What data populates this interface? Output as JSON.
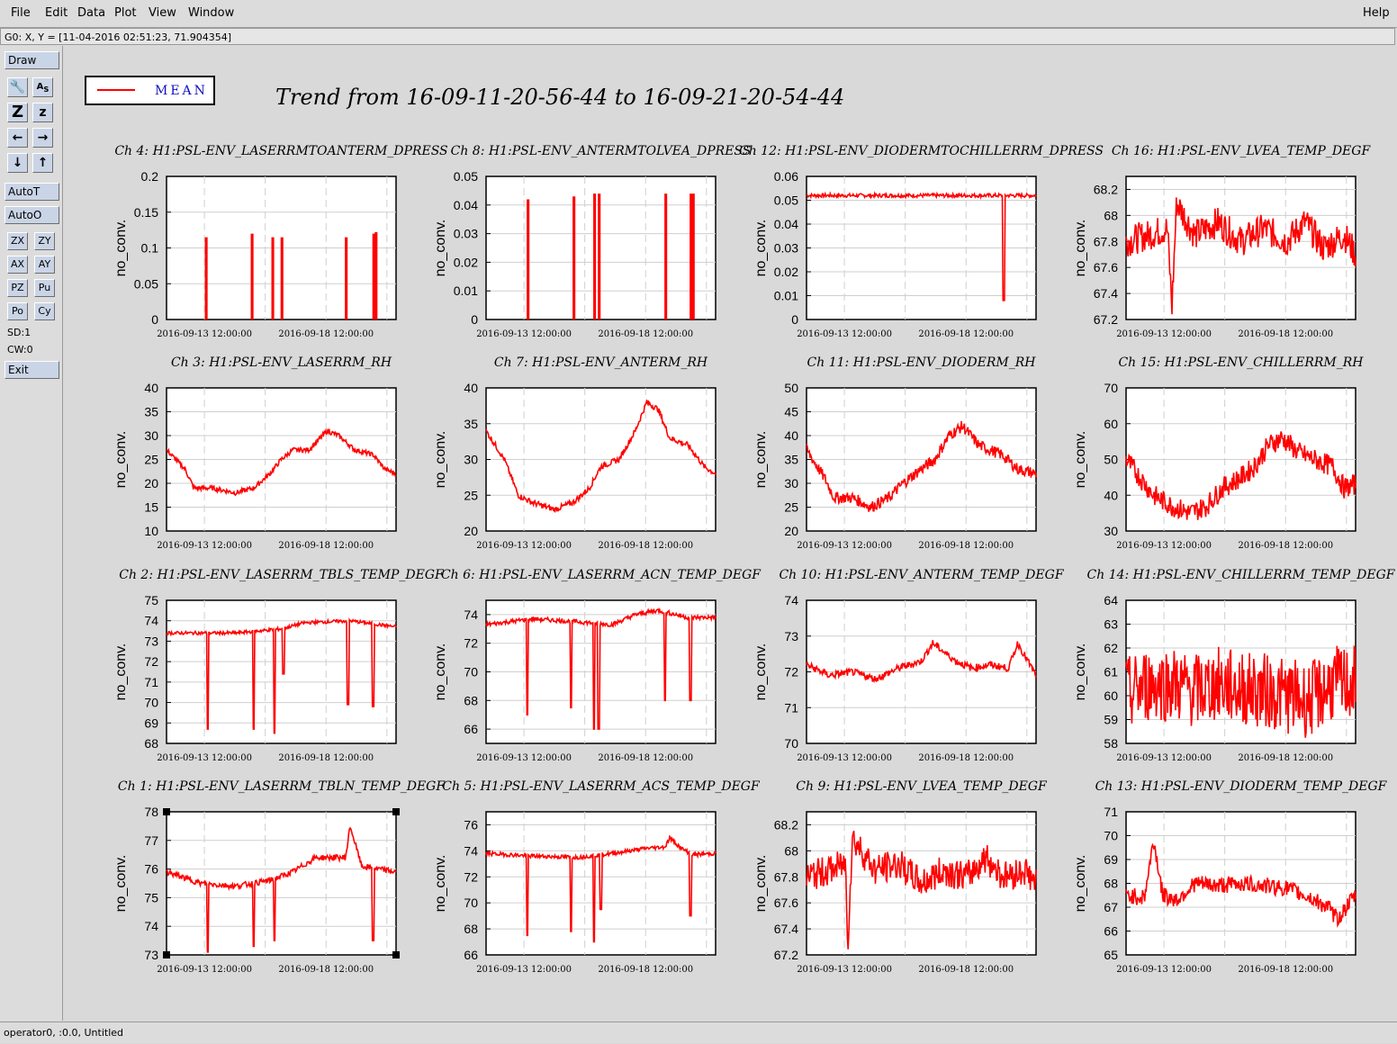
{
  "menu": {
    "items": [
      "File",
      "Edit",
      "Data",
      "Plot",
      "View",
      "Window"
    ],
    "help": "Help"
  },
  "coord_readout": "G0: X, Y = [11-04-2016 02:51:23, 71.904354]",
  "toolbar": {
    "draw": "Draw",
    "icons": [
      "wrench-icon",
      "text-icon",
      "zoom-z-icon",
      "z-icon",
      "arrow-left-icon",
      "arrow-right-icon",
      "arrow-down-icon",
      "arrow-up-icon"
    ],
    "autot": "AutoT",
    "autoo": "AutoO",
    "grid_buttons": [
      "ZX",
      "ZY",
      "AX",
      "AY",
      "PZ",
      "Pu",
      "Po",
      "Cy"
    ],
    "sd": "SD:1",
    "cw": "CW:0",
    "exit": "Exit"
  },
  "status": "operator0, :0.0, Untitled",
  "legend": {
    "label": "MEAN",
    "color": "#ff0000"
  },
  "title": "Trend from 16-09-11-20-56-44 to 16-09-21-20-54-44",
  "x_tick_labels": [
    "2016-09-13 12:00:00",
    "2016-09-18 12:00:00"
  ],
  "chart_data": [
    {
      "type": "line",
      "title": "Ch 4: H1:PSL-ENV_LASERRMTOANTERM_DPRESS",
      "ylabel": "no_conv.",
      "ylim": [
        0,
        0.2
      ],
      "yticks": [
        "0",
        "0.05",
        "0.1",
        "0.15",
        "0.2"
      ],
      "profile": "spikes",
      "spikes": [
        0.17,
        0.37,
        0.46,
        0.5,
        0.78,
        0.9,
        0.91
      ],
      "spike_heights": [
        0.115,
        0.12,
        0.115,
        0.115,
        0.115,
        0.12,
        0.122
      ],
      "base": 0
    },
    {
      "type": "line",
      "title": "Ch 8: H1:PSL-ENV_ANTERMTOLVEA_DPRESS",
      "ylabel": "no_conv.",
      "ylim": [
        0,
        0.05
      ],
      "yticks": [
        "0",
        "0.01",
        "0.02",
        "0.03",
        "0.04",
        "0.05"
      ],
      "profile": "spikes",
      "spikes": [
        0.18,
        0.38,
        0.47,
        0.49,
        0.78,
        0.89,
        0.9
      ],
      "spike_heights": [
        0.042,
        0.043,
        0.044,
        0.044,
        0.044,
        0.044,
        0.044
      ],
      "base": 0
    },
    {
      "type": "line",
      "title": "Ch 12: H1:PSL-ENV_DIODERMTOCHILLERRM_DPRESS",
      "ylabel": "no_conv.",
      "ylim": [
        0,
        0.06
      ],
      "yticks": [
        "0",
        "0.01",
        "0.02",
        "0.03",
        "0.04",
        "0.05",
        "0.06"
      ],
      "profile": "flat-dip",
      "level": 0.052,
      "noise": 0.0008,
      "dip_at": 0.86,
      "dip_to": 0.008
    },
    {
      "type": "line",
      "title": "Ch 16: H1:PSL-ENV_LVEA_TEMP_DEGF",
      "ylabel": "no_conv.",
      "ylim": [
        67.2,
        68.3
      ],
      "yticks": [
        "67.2",
        "67.4",
        "67.6",
        "67.8",
        "68",
        "68.2"
      ],
      "profile": "osc",
      "keys": [
        [
          0,
          67.8
        ],
        [
          0.1,
          67.85
        ],
        [
          0.18,
          67.9
        ],
        [
          0.2,
          67.3
        ],
        [
          0.22,
          68.1
        ],
        [
          0.3,
          67.85
        ],
        [
          0.4,
          67.95
        ],
        [
          0.5,
          67.8
        ],
        [
          0.6,
          67.9
        ],
        [
          0.7,
          67.8
        ],
        [
          0.78,
          67.95
        ],
        [
          0.86,
          67.75
        ],
        [
          0.95,
          67.85
        ],
        [
          1,
          67.7
        ]
      ],
      "noise": 0.12
    },
    {
      "type": "line",
      "title": "Ch 3: H1:PSL-ENV_LASERRM_RH",
      "ylabel": "no_conv.",
      "ylim": [
        10,
        40
      ],
      "yticks": [
        "10",
        "15",
        "20",
        "25",
        "30",
        "35",
        "40"
      ],
      "profile": "smooth",
      "keys": [
        [
          0,
          27
        ],
        [
          0.08,
          23
        ],
        [
          0.12,
          19
        ],
        [
          0.2,
          19
        ],
        [
          0.3,
          18
        ],
        [
          0.38,
          19
        ],
        [
          0.45,
          22
        ],
        [
          0.5,
          25
        ],
        [
          0.55,
          27
        ],
        [
          0.62,
          27
        ],
        [
          0.7,
          31
        ],
        [
          0.75,
          30
        ],
        [
          0.82,
          27
        ],
        [
          0.9,
          26
        ],
        [
          0.95,
          23
        ],
        [
          1,
          22
        ]
      ],
      "noise": 0.5
    },
    {
      "type": "line",
      "title": "Ch 7: H1:PSL-ENV_ANTERM_RH",
      "ylabel": "no_conv.",
      "ylim": [
        20,
        40
      ],
      "yticks": [
        "20",
        "25",
        "30",
        "35",
        "40"
      ],
      "profile": "smooth",
      "keys": [
        [
          0,
          34
        ],
        [
          0.08,
          30
        ],
        [
          0.14,
          25
        ],
        [
          0.2,
          24
        ],
        [
          0.3,
          23
        ],
        [
          0.38,
          24
        ],
        [
          0.45,
          26
        ],
        [
          0.5,
          29
        ],
        [
          0.58,
          30
        ],
        [
          0.65,
          34
        ],
        [
          0.7,
          38
        ],
        [
          0.75,
          37
        ],
        [
          0.8,
          33
        ],
        [
          0.88,
          32
        ],
        [
          0.95,
          29
        ],
        [
          1,
          28
        ]
      ],
      "noise": 0.4
    },
    {
      "type": "line",
      "title": "Ch 11: H1:PSL-ENV_DIODERM_RH",
      "ylabel": "no_conv.",
      "ylim": [
        20,
        50
      ],
      "yticks": [
        "20",
        "25",
        "30",
        "35",
        "40",
        "45",
        "50"
      ],
      "profile": "smooth",
      "keys": [
        [
          0,
          37
        ],
        [
          0.08,
          31
        ],
        [
          0.12,
          27
        ],
        [
          0.2,
          27
        ],
        [
          0.28,
          25
        ],
        [
          0.36,
          27
        ],
        [
          0.42,
          30
        ],
        [
          0.5,
          33
        ],
        [
          0.56,
          35
        ],
        [
          0.62,
          40
        ],
        [
          0.68,
          42
        ],
        [
          0.75,
          38
        ],
        [
          0.85,
          36
        ],
        [
          0.92,
          33
        ],
        [
          1,
          32
        ]
      ],
      "noise": 1.2
    },
    {
      "type": "line",
      "title": "Ch 15: H1:PSL-ENV_CHILLERRM_RH",
      "ylabel": "no_conv.",
      "ylim": [
        30,
        70
      ],
      "yticks": [
        "30",
        "40",
        "50",
        "60",
        "70"
      ],
      "profile": "smooth",
      "keys": [
        [
          0,
          50
        ],
        [
          0.06,
          45
        ],
        [
          0.12,
          40
        ],
        [
          0.2,
          37
        ],
        [
          0.28,
          35
        ],
        [
          0.35,
          37
        ],
        [
          0.42,
          42
        ],
        [
          0.5,
          45
        ],
        [
          0.56,
          48
        ],
        [
          0.62,
          54
        ],
        [
          0.68,
          56
        ],
        [
          0.75,
          52
        ],
        [
          0.82,
          50
        ],
        [
          0.9,
          48
        ],
        [
          0.95,
          42
        ],
        [
          1,
          43
        ]
      ],
      "noise": 3
    },
    {
      "type": "line",
      "title": "Ch 2: H1:PSL-ENV_LASERRM_TBLS_TEMP_DEGF",
      "ylabel": "no_conv.",
      "ylim": [
        68,
        75
      ],
      "yticks": [
        "68",
        "69",
        "70",
        "71",
        "72",
        "73",
        "74",
        "75"
      ],
      "profile": "dips",
      "keys": [
        [
          0,
          73.4
        ],
        [
          0.3,
          73.4
        ],
        [
          0.5,
          73.6
        ],
        [
          0.6,
          73.9
        ],
        [
          0.8,
          74
        ],
        [
          1,
          73.7
        ]
      ],
      "noise": 0.08,
      "dips": [
        [
          0.18,
          68.7
        ],
        [
          0.38,
          68.7
        ],
        [
          0.47,
          68.5
        ],
        [
          0.51,
          71.4
        ],
        [
          0.79,
          69.9
        ],
        [
          0.9,
          69.8
        ]
      ]
    },
    {
      "type": "line",
      "title": "Ch 6: H1:PSL-ENV_LASERRM_ACN_TEMP_DEGF",
      "ylabel": "no_conv.",
      "ylim": [
        65,
        75
      ],
      "yticks": [
        "66",
        "68",
        "70",
        "72",
        "74"
      ],
      "profile": "dips",
      "keys": [
        [
          0,
          73.3
        ],
        [
          0.2,
          73.7
        ],
        [
          0.4,
          73.5
        ],
        [
          0.55,
          73.3
        ],
        [
          0.65,
          74
        ],
        [
          0.75,
          74.3
        ],
        [
          0.88,
          73.8
        ],
        [
          1,
          73.8
        ]
      ],
      "noise": 0.15,
      "dips": [
        [
          0.18,
          67
        ],
        [
          0.37,
          67.5
        ],
        [
          0.47,
          66
        ],
        [
          0.49,
          66
        ],
        [
          0.78,
          68
        ],
        [
          0.89,
          68
        ]
      ]
    },
    {
      "type": "line",
      "title": "Ch 10: H1:PSL-ENV_ANTERM_TEMP_DEGF",
      "ylabel": "no_conv.",
      "ylim": [
        70,
        74
      ],
      "yticks": [
        "70",
        "71",
        "72",
        "73",
        "74"
      ],
      "profile": "osc",
      "keys": [
        [
          0,
          72.2
        ],
        [
          0.1,
          71.9
        ],
        [
          0.2,
          72
        ],
        [
          0.3,
          71.8
        ],
        [
          0.4,
          72.1
        ],
        [
          0.5,
          72.3
        ],
        [
          0.55,
          72.8
        ],
        [
          0.65,
          72.3
        ],
        [
          0.72,
          72.1
        ],
        [
          0.8,
          72.2
        ],
        [
          0.88,
          72.1
        ],
        [
          0.92,
          72.8
        ],
        [
          1,
          71.9
        ]
      ],
      "noise": 0.1
    },
    {
      "type": "line",
      "title": "Ch 14: H1:PSL-ENV_CHILLERRM_TEMP_DEGF",
      "ylabel": "no_conv.",
      "ylim": [
        58,
        64
      ],
      "yticks": [
        "58",
        "59",
        "60",
        "61",
        "62",
        "63",
        "64"
      ],
      "profile": "osc",
      "keys": [
        [
          0,
          60
        ],
        [
          0.1,
          60.5
        ],
        [
          0.2,
          60.5
        ],
        [
          0.3,
          60.2
        ],
        [
          0.4,
          60.5
        ],
        [
          0.5,
          60.3
        ],
        [
          0.6,
          60.2
        ],
        [
          0.7,
          60
        ],
        [
          0.8,
          59.8
        ],
        [
          0.9,
          60.5
        ],
        [
          1,
          60.5
        ]
      ],
      "noise": 1.6
    },
    {
      "type": "line",
      "title": "Ch 1: H1:PSL-ENV_LASERRM_TBLN_TEMP_DEGF",
      "ylabel": "no_conv.",
      "ylim": [
        73,
        78
      ],
      "yticks": [
        "73",
        "74",
        "75",
        "76",
        "77",
        "78"
      ],
      "profile": "dips",
      "keys": [
        [
          0,
          75.9
        ],
        [
          0.15,
          75.5
        ],
        [
          0.3,
          75.4
        ],
        [
          0.45,
          75.6
        ],
        [
          0.55,
          75.9
        ],
        [
          0.65,
          76.4
        ],
        [
          0.78,
          76.4
        ],
        [
          0.8,
          77.5
        ],
        [
          0.85,
          76.1
        ],
        [
          1,
          75.9
        ]
      ],
      "noise": 0.1,
      "dips": [
        [
          0.18,
          73.1
        ],
        [
          0.38,
          73.3
        ],
        [
          0.47,
          73.5
        ],
        [
          0.9,
          73.5
        ]
      ]
    },
    {
      "type": "line",
      "title": "Ch 5: H1:PSL-ENV_LASERRM_ACS_TEMP_DEGF",
      "ylabel": "no_conv.",
      "ylim": [
        66,
        77
      ],
      "yticks": [
        "66",
        "68",
        "70",
        "72",
        "74",
        "76"
      ],
      "profile": "dips",
      "keys": [
        [
          0,
          73.8
        ],
        [
          0.2,
          73.6
        ],
        [
          0.4,
          73.5
        ],
        [
          0.55,
          73.8
        ],
        [
          0.7,
          74.2
        ],
        [
          0.78,
          74.3
        ],
        [
          0.8,
          75
        ],
        [
          0.85,
          74.2
        ],
        [
          0.9,
          73.7
        ],
        [
          1,
          73.8
        ]
      ],
      "noise": 0.15,
      "dips": [
        [
          0.18,
          67.5
        ],
        [
          0.37,
          67.8
        ],
        [
          0.47,
          67
        ],
        [
          0.5,
          69.5
        ],
        [
          0.89,
          69
        ]
      ]
    },
    {
      "type": "line",
      "title": "Ch 9: H1:PSL-ENV_LVEA_TEMP_DEGF",
      "ylabel": "no_conv.",
      "ylim": [
        67.2,
        68.3
      ],
      "yticks": [
        "67.2",
        "67.4",
        "67.6",
        "67.8",
        "68",
        "68.2"
      ],
      "profile": "osc",
      "keys": [
        [
          0,
          67.8
        ],
        [
          0.1,
          67.85
        ],
        [
          0.17,
          67.9
        ],
        [
          0.18,
          67.3
        ],
        [
          0.2,
          68.1
        ],
        [
          0.3,
          67.85
        ],
        [
          0.4,
          67.9
        ],
        [
          0.5,
          67.75
        ],
        [
          0.6,
          67.85
        ],
        [
          0.7,
          67.8
        ],
        [
          0.78,
          67.95
        ],
        [
          0.86,
          67.8
        ],
        [
          0.95,
          67.85
        ],
        [
          1,
          67.75
        ]
      ],
      "noise": 0.12
    },
    {
      "type": "line",
      "title": "Ch 13: H1:PSL-ENV_DIODERM_TEMP_DEGF",
      "ylabel": "no_conv.",
      "ylim": [
        65,
        71
      ],
      "yticks": [
        "65",
        "66",
        "67",
        "68",
        "69",
        "70",
        "71"
      ],
      "profile": "osc",
      "keys": [
        [
          0,
          67.5
        ],
        [
          0.08,
          67.4
        ],
        [
          0.12,
          69.8
        ],
        [
          0.16,
          67.5
        ],
        [
          0.22,
          67.3
        ],
        [
          0.3,
          68
        ],
        [
          0.4,
          67.9
        ],
        [
          0.5,
          68
        ],
        [
          0.6,
          67.9
        ],
        [
          0.7,
          67.8
        ],
        [
          0.8,
          67.4
        ],
        [
          0.88,
          67
        ],
        [
          0.92,
          66.5
        ],
        [
          1,
          67.5
        ]
      ],
      "noise": 0.35
    }
  ]
}
